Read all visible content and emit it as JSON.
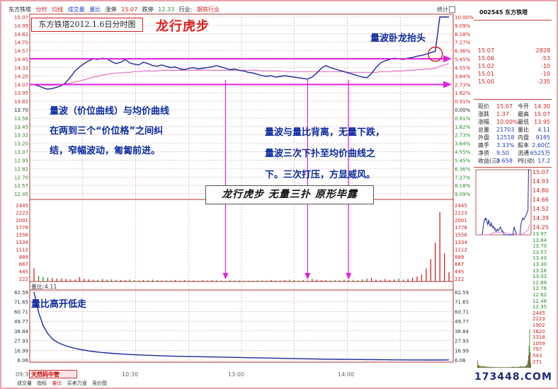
{
  "chart_header": {
    "stock_name": "东方铁塔",
    "tab_time": "分时",
    "tab_avg": "均线",
    "tab_vol": "成交量",
    "tab_ratio": "量比",
    "hold_label": "涨停",
    "last_price": "15.07",
    "drop_label": "跌停",
    "drop_price": "12.33",
    "sector_label": "行业:",
    "sector": "钢铁行业",
    "stat_button": "统计"
  },
  "titles": {
    "chart_box": "东方铁塔2012.1.6日分时图",
    "red_title": "龙行虎步",
    "banner": "龙行虎步  无量三扑  原形毕露",
    "vol_ratio_label": "量比:4.11"
  },
  "annotations": {
    "top_right": "量波卧龙抬头",
    "left_block": "量波（价位曲线）与均价曲线\n在两到三个“价位格”之间纠\n结，窄幅波动，匍匐前进。",
    "right_block": "量波与量比背离，无量下跌，\n量波三次下扑至均价曲线之\n下。三次打压，方显威风。",
    "lower_title": "量比高开低走"
  },
  "time_labels": [
    "09:30",
    "10:30",
    "13:00",
    "14:00"
  ],
  "bottom_tabs": [
    "成交量",
    "指标",
    "量比",
    "买卖力道",
    "竞价图"
  ],
  "brand": "天然码中管",
  "watermark": "173448.COM",
  "colors": {
    "price_line": "#1a2a9a",
    "avg_line": "#e070c0",
    "magenta_arrow": "#e020e0",
    "up": "#d02020",
    "down": "#2a8a2a",
    "grid": "#d0a0a0"
  },
  "right_panel": {
    "code": "002545 东方铁塔",
    "ask_rows": [
      {
        "label": "15.07",
        "value": "2828"
      },
      {
        "label": "15.06",
        "value": "-53"
      },
      {
        "label": "15.02",
        "value": "-10"
      },
      {
        "label": "15.01",
        "value": "-10"
      },
      {
        "label": "15.00",
        "value": "-235"
      }
    ],
    "quote_rows": [
      {
        "a": "现价",
        "b": "15.07",
        "c": "今开",
        "d": "14.30"
      },
      {
        "a": "涨跌",
        "b": "1.37",
        "c": "最高",
        "d": "15.07"
      },
      {
        "a": "涨幅",
        "b": "10.00%",
        "c": "最低",
        "d": "13.95"
      },
      {
        "a": "总量",
        "b": "21703",
        "c": "量比",
        "d": "4.11"
      },
      {
        "a": "外盘",
        "b": "12518",
        "c": "内盘",
        "d": "9185"
      },
      {
        "a": "换手",
        "b": "3.33%",
        "c": "股本",
        "d": "2.60亿"
      },
      {
        "a": "净资",
        "b": "9.50",
        "c": "流通",
        "d": "6525万"
      },
      {
        "a": "收益(三)",
        "b": "0.658",
        "c": "PE(动)",
        "d": "17.2"
      }
    ],
    "mini_ticks": [
      "15.07",
      "14.93",
      "14.80",
      "14.66",
      "14.52",
      "14.39",
      "14.25"
    ],
    "tick_list": [
      "13.97",
      "13.84",
      "13.70",
      "13.57",
      "13.43",
      "13.30",
      "13.16",
      "13.03",
      "12.89",
      "12.76",
      "12.62",
      "12.48",
      "12.35",
      "2445",
      "2223",
      "1902",
      "1620",
      "1318",
      "1059",
      "797",
      "543",
      "271"
    ]
  },
  "chart_data": {
    "type": "line",
    "title": "东方铁塔2012.1.6日分时图",
    "price_axis": {
      "left_ticks": [
        "15.07",
        "14.95",
        "14.82",
        "14.70",
        "14.57",
        "14.45",
        "14.32",
        "14.20",
        "14.07",
        "13.95",
        "13.82",
        "13.70",
        "13.58",
        "13.45",
        "13.32",
        "13.20",
        "13.07",
        "12.95",
        "12.82",
        "12.70",
        "12.57",
        "12.45"
      ],
      "right_ticks": [
        "10.00%",
        "9.09%",
        "8.18%",
        "7.27%",
        "6.36%",
        "5.45%",
        "4.55%",
        "3.64%",
        "2.73%",
        "1.82%",
        "0.91%",
        "0.00%",
        "0.91%",
        "1.82%",
        "2.73%",
        "3.64%",
        "4.55%",
        "5.45%",
        "6.36%",
        "7.27%",
        "8.18%",
        "9.09%"
      ],
      "ylim": [
        12.45,
        15.07
      ]
    },
    "volume_axis": {
      "ticks": [
        "2445",
        "2223",
        "2001",
        "1778",
        "1556",
        "1334",
        "1112",
        "889",
        "667",
        "445",
        "222"
      ],
      "ylim": [
        0,
        2445
      ]
    },
    "ratio_axis": {
      "ticks": [
        "82.59",
        "71.65",
        "60.71",
        "49.77",
        "38.84",
        "27.93",
        "16.99",
        "6.06"
      ],
      "ylim": [
        6.06,
        82.59
      ]
    },
    "price_series": [
      14.07,
      14.05,
      14.02,
      14.0,
      14.01,
      14.03,
      14.05,
      14.1,
      14.18,
      14.27,
      14.33,
      14.38,
      14.42,
      14.45,
      14.44,
      14.46,
      14.45,
      14.41,
      14.38,
      14.4,
      14.44,
      14.39,
      14.37,
      14.36,
      14.4,
      14.38,
      14.35,
      14.34,
      14.36,
      14.34,
      14.32,
      14.33,
      14.3,
      14.29,
      14.31,
      14.32,
      14.3,
      14.31,
      14.32,
      14.33,
      14.35,
      14.33,
      14.31,
      14.29,
      14.3,
      14.28,
      14.27,
      14.25,
      14.24,
      14.22,
      14.2,
      14.19,
      14.2,
      14.18,
      14.19,
      14.2,
      14.19,
      14.18,
      14.17,
      14.16,
      14.15,
      14.18,
      14.24,
      14.31,
      14.35,
      14.32,
      14.3,
      14.28,
      14.26,
      14.24,
      14.22,
      14.2,
      14.18,
      14.17,
      14.23,
      14.32,
      14.39,
      14.42,
      14.44,
      14.46,
      14.45,
      14.44,
      14.46,
      14.47,
      14.49,
      14.5,
      14.52,
      14.54,
      14.56,
      15.07,
      15.07,
      15.07
    ],
    "avg_series": [
      14.07,
      14.07,
      14.06,
      14.06,
      14.06,
      14.06,
      14.07,
      14.08,
      14.09,
      14.11,
      14.12,
      14.14,
      14.16,
      14.18,
      14.19,
      14.21,
      14.22,
      14.23,
      14.24,
      14.24,
      14.25,
      14.25,
      14.26,
      14.26,
      14.27,
      14.27,
      14.27,
      14.27,
      14.28,
      14.28,
      14.28,
      14.28,
      14.28,
      14.28,
      14.28,
      14.28,
      14.28,
      14.28,
      14.28,
      14.28,
      14.28,
      14.28,
      14.28,
      14.28,
      14.28,
      14.28,
      14.28,
      14.28,
      14.28,
      14.28,
      14.27,
      14.27,
      14.27,
      14.27,
      14.27,
      14.26,
      14.26,
      14.26,
      14.26,
      14.26,
      14.26,
      14.26,
      14.26,
      14.26,
      14.26,
      14.26,
      14.26,
      14.26,
      14.26,
      14.25,
      14.25,
      14.25,
      14.25,
      14.25,
      14.25,
      14.25,
      14.26,
      14.26,
      14.26,
      14.27,
      14.27,
      14.27,
      14.28,
      14.28,
      14.29,
      14.29,
      14.3,
      14.3,
      14.31,
      14.34,
      14.36,
      14.38
    ],
    "volume_series": [
      420,
      180,
      140,
      120,
      110,
      90,
      95,
      80,
      70,
      60,
      140,
      90,
      70,
      60,
      50,
      80,
      60,
      70,
      55,
      50,
      45,
      60,
      40,
      35,
      50,
      40,
      60,
      45,
      30,
      40,
      35,
      50,
      30,
      45,
      30,
      35,
      25,
      40,
      30,
      45,
      35,
      30,
      25,
      40,
      30,
      35,
      25,
      30,
      25,
      40,
      35,
      30,
      50,
      35,
      30,
      45,
      60,
      40,
      30,
      50,
      35,
      80,
      60,
      45,
      40,
      35,
      50,
      40,
      60,
      45,
      55,
      40,
      70,
      90,
      110,
      60,
      50,
      80,
      55,
      70,
      90,
      60,
      80,
      120,
      160,
      220,
      420,
      720,
      1250,
      2223,
      900,
      300
    ],
    "ratio_series": [
      82.59,
      60.0,
      45.0,
      36.0,
      30.0,
      26.5,
      24.0,
      22.0,
      20.5,
      19.2,
      18.1,
      17.2,
      16.3,
      15.6,
      15.0,
      14.5,
      14.0,
      13.6,
      13.2,
      12.9,
      12.6,
      12.3,
      12.0,
      11.8,
      11.6,
      11.4,
      11.2,
      11.0,
      10.8,
      10.6,
      10.5,
      10.3,
      10.2,
      10.1,
      10.0,
      9.9,
      9.8,
      9.7,
      9.6,
      9.5,
      9.4,
      9.3,
      9.2,
      9.1,
      9.0,
      8.9,
      8.8,
      8.7,
      8.6,
      8.5,
      8.4,
      8.3,
      8.2,
      8.1,
      8.0,
      7.9,
      7.8,
      7.7,
      7.6,
      7.5,
      7.4,
      7.3,
      7.2,
      7.1,
      7.0,
      6.95,
      6.9,
      6.85,
      6.8,
      6.75,
      6.7,
      6.65,
      6.6,
      6.55,
      6.5,
      6.45,
      6.4,
      6.35,
      6.3,
      6.25,
      6.2,
      6.18,
      6.16,
      6.14,
      6.12,
      6.1,
      6.08,
      6.07,
      6.06,
      6.08,
      6.1,
      6.12
    ],
    "reference_lines": [
      14.45,
      14.07
    ],
    "markers_at": [
      42,
      60,
      69
    ]
  }
}
